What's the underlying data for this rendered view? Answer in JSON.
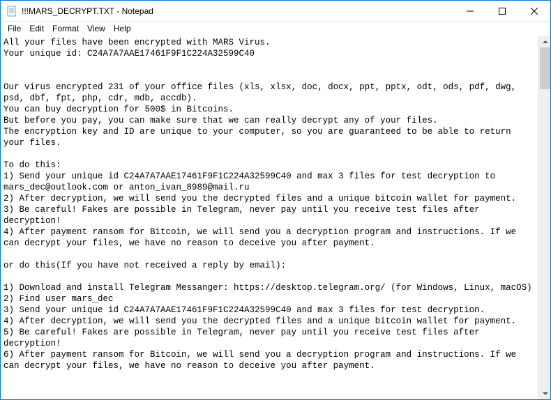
{
  "titlebar": {
    "title": "!!!MARS_DECRYPT.TXT - Notepad"
  },
  "menu": {
    "file": "File",
    "edit": "Edit",
    "format": "Format",
    "view": "View",
    "help": "Help"
  },
  "content": "All your files have been encrypted with MARS Virus.\nYour unique id: C24A7A7AAE17461F9F1C224A32599C40\n\n\nOur virus encrypted 231 of your office files (xls, xlsx, doc, docx, ppt, pptx, odt, ods, pdf, dwg, psd, dbf, fpt, php, cdr, mdb, accdb).\nYou can buy decryption for 500$ in Bitcoins.\nBut before you pay, you can make sure that we can really decrypt any of your files.\nThe encryption key and ID are unique to your computer, so you are guaranteed to be able to return your files.\n\nTo do this:\n1) Send your unique id C24A7A7AAE17461F9F1C224A32599C40 and max 3 files for test decryption to mars_dec@outlook.com or anton_ivan_8989@mail.ru\n2) After decryption, we will send you the decrypted files and a unique bitcoin wallet for payment.\n3) Be careful! Fakes are possible in Telegram, never pay until you receive test files after decryption!\n4) After payment ransom for Bitcoin, we will send you a decryption program and instructions. If we can decrypt your files, we have no reason to deceive you after payment.\n\nor do this(If you have not received a reply by email):\n\n1) Download and install Telegram Messanger: https://desktop.telegram.org/ (for Windows, Linux, macOS)\n2) Find user mars_dec\n3) Send your unique id C24A7A7AAE17461F9F1C224A32599C40 and max 3 files for test decryption.\n4) After decryption, we will send you the decrypted files and a unique bitcoin wallet for payment.\n5) Be careful! Fakes are possible in Telegram, never pay until you receive test files after decryption!\n6) After payment ransom for Bitcoin, we will send you a decryption program and instructions. If we can decrypt your files, we have no reason to deceive you after payment."
}
